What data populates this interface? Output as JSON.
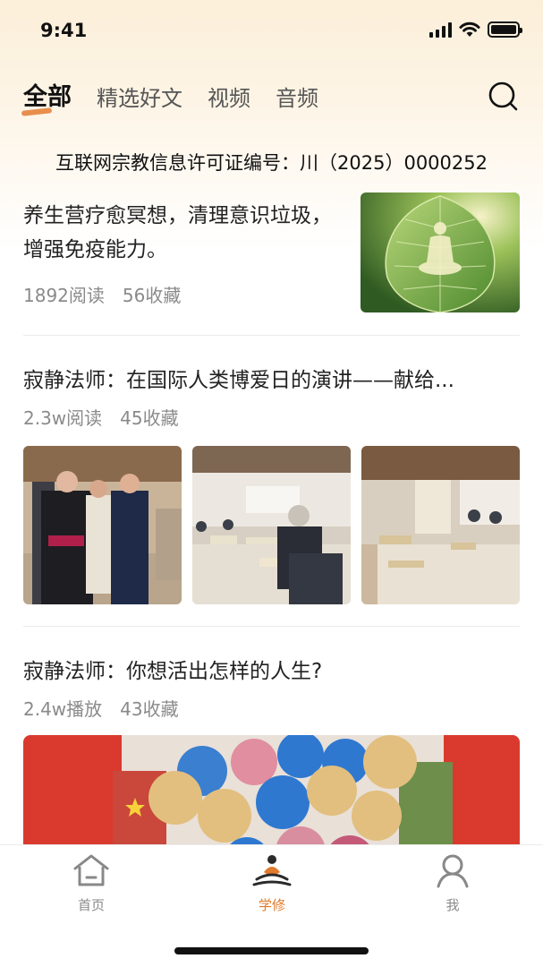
{
  "status": {
    "time": "9:41"
  },
  "tabs": [
    {
      "label": "全部",
      "active": true
    },
    {
      "label": "精选好文",
      "active": false
    },
    {
      "label": "视频",
      "active": false
    },
    {
      "label": "音频",
      "active": false
    }
  ],
  "license": "互联网宗教信息许可证编号：川（2025）0000252",
  "articles": [
    {
      "title": "养生营疗愈冥想，清理意识垃圾，增强免疫能力。",
      "reads": "1892阅读",
      "favorites": "56收藏",
      "thumb_icon": "bodhi-leaf-meditation-image"
    },
    {
      "title": "寂静法师：在国际人类博爱日的演讲——献给...",
      "reads": "2.3w阅读",
      "favorites": "45收藏"
    },
    {
      "title": "寂静法师：你想活出怎样的人生?",
      "reads": "2.4w播放",
      "favorites": "43收藏"
    }
  ],
  "nav": [
    {
      "label": "首页",
      "icon": "home-icon",
      "active": false
    },
    {
      "label": "学修",
      "icon": "meditation-icon",
      "active": true
    },
    {
      "label": "我",
      "icon": "profile-icon",
      "active": false
    }
  ],
  "colors": {
    "accent": "#e07a2c",
    "muted": "#8a8a8a"
  }
}
